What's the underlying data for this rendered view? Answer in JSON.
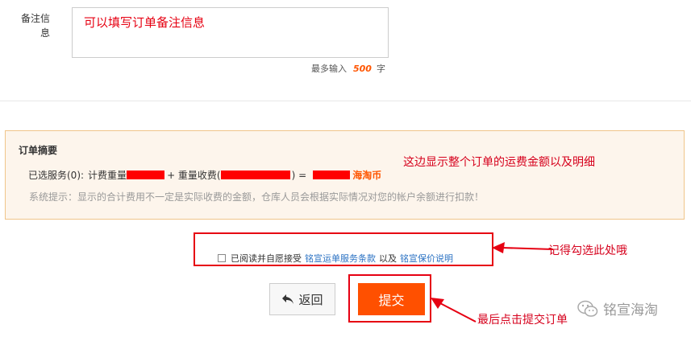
{
  "remark": {
    "label": "备注信息",
    "text": "可以填写订单备注信息",
    "max_prefix": "最多输入",
    "max_value": "500",
    "max_suffix": "字"
  },
  "summary": {
    "title": "订单摘要",
    "selected_services": "已选服务(0):",
    "billing_weight": "计费重量",
    "plus_weight_fee": "+ 重量收费(",
    "equals": ") =",
    "currency": "海淘币",
    "system_tip": "系统提示：显示的合计费用不一定是实际收费的金额，仓库人员会根据实际情况对您的帐户余额进行扣款！",
    "annotation": "这边显示整个订单的运费金额以及明细"
  },
  "agreement": {
    "prefix": "已阅读并自愿接受",
    "link1": "铭宣运单服务条款",
    "and": "以及",
    "link2": "铭宣保价说明",
    "checked": false,
    "annotation": "记得勾选此处哦"
  },
  "actions": {
    "back_label": "返回",
    "submit_label": "提交",
    "submit_annotation": "最后点击提交订单"
  },
  "watermark": {
    "text": "铭宣海淘",
    "icon": "wechat-icon"
  },
  "colors": {
    "annotation_red": "#d6001c",
    "accent_orange": "#ff5000",
    "link_blue": "#2b72c3",
    "summary_bg": "#fdf5ec"
  }
}
